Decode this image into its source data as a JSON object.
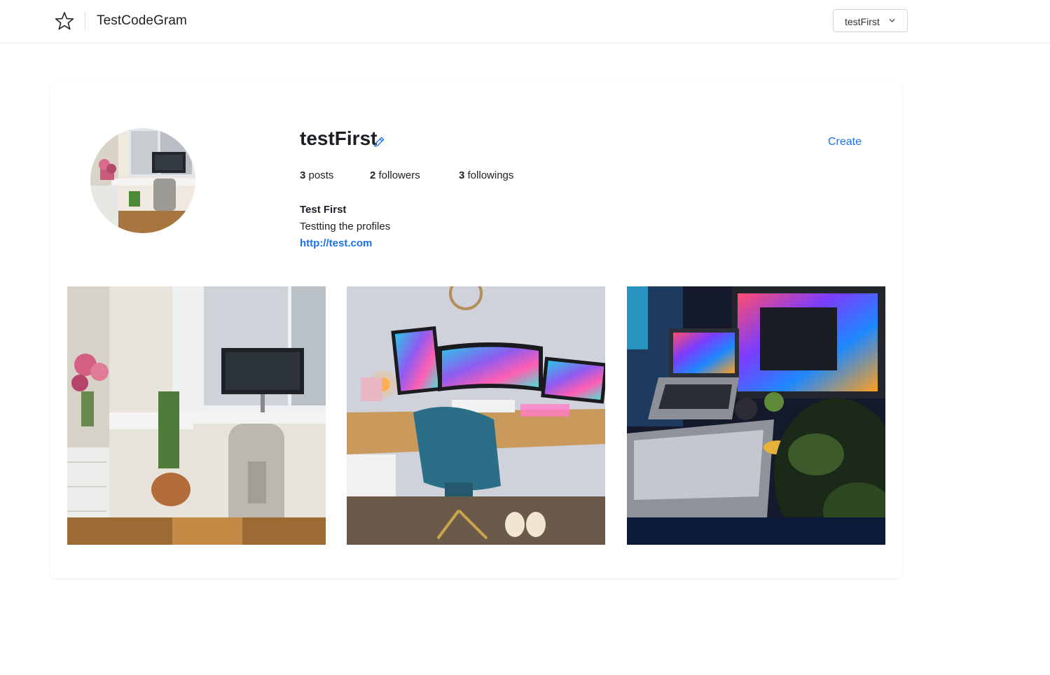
{
  "navbar": {
    "brand_title": "TestCodeGram",
    "brand_icon": "star-icon",
    "user_menu_label": "testFirst",
    "user_menu_icon": "chevron-down-icon"
  },
  "profile": {
    "username": "testFirst",
    "edit_icon": "pencil-icon",
    "create_label": "Create",
    "stats": {
      "posts_count": "3",
      "posts_label": "posts",
      "followers_count": "2",
      "followers_label": "followers",
      "following_count": "3",
      "following_label": "followings"
    },
    "full_name": "Test First",
    "bio": "Testting the profiles",
    "website": "http://test.com"
  },
  "posts": [
    {
      "name": "post-desk-plants"
    },
    {
      "name": "post-desk-curved-monitor"
    },
    {
      "name": "post-desk-night-setup"
    }
  ],
  "colors": {
    "accent": "#1a73e8",
    "text": "#1b1f23",
    "border": "#d6d6d6"
  }
}
